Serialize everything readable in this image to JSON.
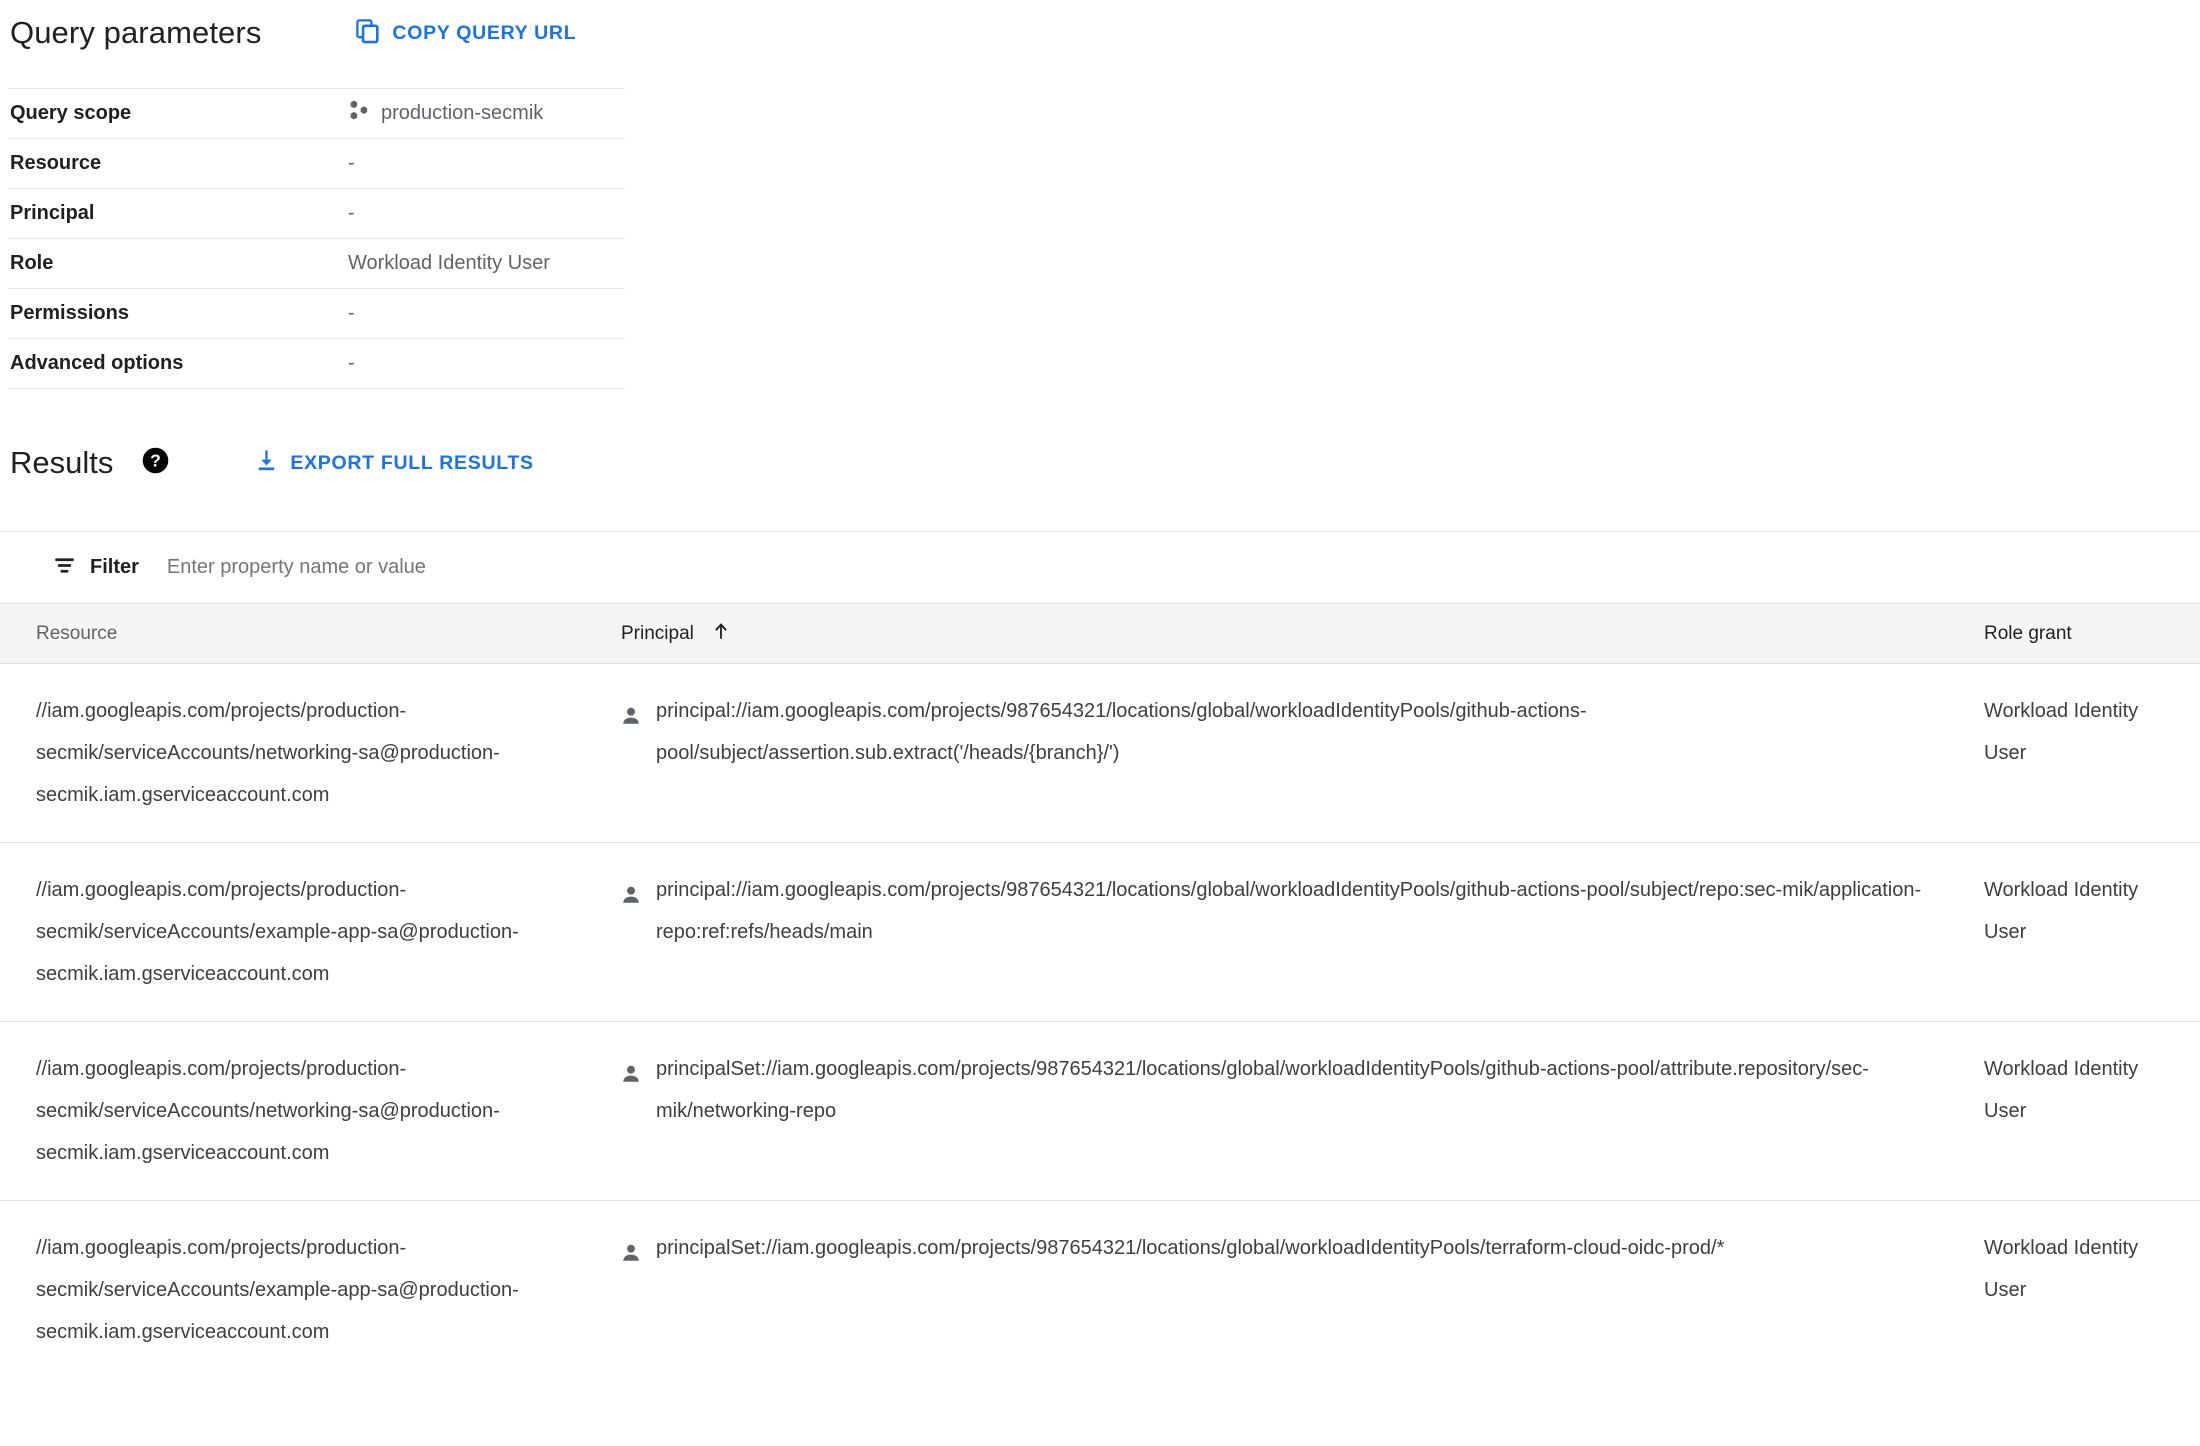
{
  "query_parameters": {
    "title": "Query parameters",
    "copy_button_label": "COPY QUERY URL",
    "copy_icon": "copy-icon",
    "rows": [
      {
        "key": "Query scope",
        "value": "production-secmik",
        "icon": "gcp-project-icon"
      },
      {
        "key": "Resource",
        "value": "-",
        "icon": ""
      },
      {
        "key": "Principal",
        "value": "-",
        "icon": ""
      },
      {
        "key": "Role",
        "value": "Workload Identity User",
        "icon": ""
      },
      {
        "key": "Permissions",
        "value": "-",
        "icon": ""
      },
      {
        "key": "Advanced options",
        "value": "-",
        "icon": ""
      }
    ]
  },
  "results": {
    "title": "Results",
    "help_icon": "help-icon",
    "export_button_label": "EXPORT FULL RESULTS",
    "export_icon": "download-icon",
    "filter": {
      "icon": "filter-icon",
      "label": "Filter",
      "placeholder": "Enter property name or value",
      "value": ""
    },
    "table": {
      "columns": [
        {
          "label": "Resource",
          "sorted": false,
          "sort_direction": ""
        },
        {
          "label": "Principal",
          "sorted": true,
          "sort_direction": "asc"
        },
        {
          "label": "Role grant",
          "sorted": false,
          "sort_direction": ""
        }
      ],
      "rows": [
        {
          "resource": "//iam.googleapis.com/projects/production-secmik/serviceAccounts/networking-sa@production-secmik.iam.gserviceaccount.com",
          "principal": "principal://iam.googleapis.com/projects/987654321/locations/global/workloadIdentityPools/github-actions-pool/subject/assertion.sub.extract('/heads/{branch}/')",
          "principal_icon": "person-icon",
          "role_grant": "Workload Identity User"
        },
        {
          "resource": "//iam.googleapis.com/projects/production-secmik/serviceAccounts/example-app-sa@production-secmik.iam.gserviceaccount.com",
          "principal": "principal://iam.googleapis.com/projects/987654321/locations/global/workloadIdentityPools/github-actions-pool/subject/repo:sec-mik/application-repo:ref:refs/heads/main",
          "principal_icon": "person-icon",
          "role_grant": "Workload Identity User"
        },
        {
          "resource": "//iam.googleapis.com/projects/production-secmik/serviceAccounts/networking-sa@production-secmik.iam.gserviceaccount.com",
          "principal": "principalSet://iam.googleapis.com/projects/987654321/locations/global/workloadIdentityPools/github-actions-pool/attribute.repository/sec-mik/networking-repo",
          "principal_icon": "person-icon",
          "role_grant": "Workload Identity User"
        },
        {
          "resource": "//iam.googleapis.com/projects/production-secmik/serviceAccounts/example-app-sa@production-secmik.iam.gserviceaccount.com",
          "principal": "principalSet://iam.googleapis.com/projects/987654321/locations/global/workloadIdentityPools/terraform-cloud-oidc-prod/*",
          "principal_icon": "person-icon",
          "role_grant": "Workload Identity User"
        }
      ]
    }
  },
  "colors": {
    "link_blue": "#1a73e8",
    "text_primary": "#202124",
    "text_secondary": "#5f6368",
    "divider": "#e0e0e0",
    "header_bg": "#f5f5f5"
  }
}
